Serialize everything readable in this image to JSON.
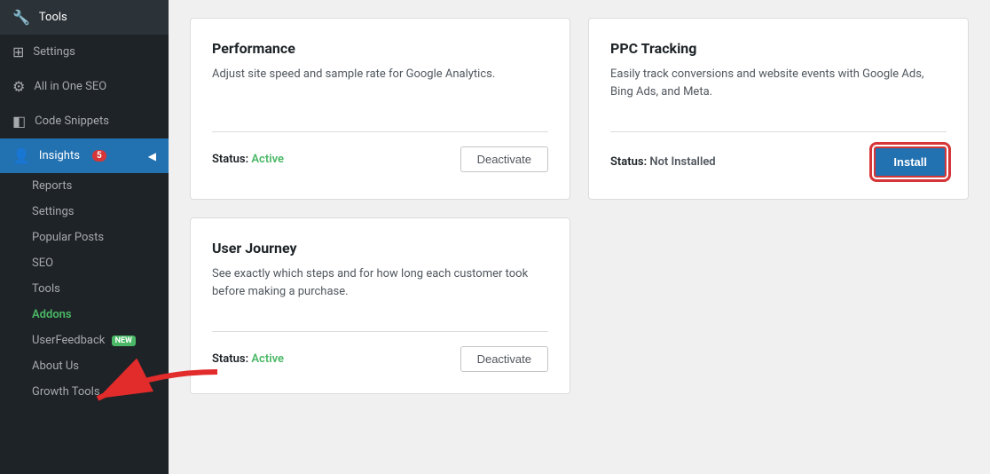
{
  "sidebar": {
    "items": [
      {
        "label": "Tools",
        "icon": "🔧",
        "id": "tools"
      },
      {
        "label": "Settings",
        "icon": "⊞",
        "id": "settings"
      },
      {
        "label": "All in One SEO",
        "icon": "⚙",
        "id": "aio-seo"
      },
      {
        "label": "Code Snippets",
        "icon": "◧",
        "id": "code-snippets"
      },
      {
        "label": "Insights",
        "icon": "👤",
        "id": "insights",
        "badge": "5"
      }
    ],
    "sub_items": [
      {
        "label": "Reports",
        "id": "reports"
      },
      {
        "label": "Settings",
        "id": "settings-sub"
      },
      {
        "label": "Popular Posts",
        "id": "popular-posts"
      },
      {
        "label": "SEO",
        "id": "seo"
      },
      {
        "label": "Tools",
        "id": "tools-sub"
      },
      {
        "label": "Addons",
        "id": "addons",
        "active": true
      },
      {
        "label": "UserFeedback",
        "id": "userfeedback",
        "new_badge": true
      },
      {
        "label": "About Us",
        "id": "about-us"
      },
      {
        "label": "Growth Tools",
        "id": "growth-tools"
      }
    ]
  },
  "cards": [
    {
      "id": "performance",
      "title": "Performance",
      "description": "Adjust site speed and sample rate for Google Analytics.",
      "status_label": "Status:",
      "status_value": "Active",
      "status_class": "active",
      "button_label": "Deactivate",
      "button_type": "deactivate"
    },
    {
      "id": "ppc-tracking",
      "title": "PPC Tracking",
      "description": "Easily track conversions and website events with Google Ads, Bing Ads, and Meta.",
      "status_label": "Status:",
      "status_value": "Not Installed",
      "status_class": "not-installed",
      "button_label": "Install",
      "button_type": "install"
    },
    {
      "id": "user-journey",
      "title": "User Journey",
      "description": "See exactly which steps and for how long each customer took before making a purchase.",
      "status_label": "Status:",
      "status_value": "Active",
      "status_class": "active",
      "button_label": "Deactivate",
      "button_type": "deactivate"
    }
  ],
  "colors": {
    "active": "#4ab866",
    "install_bg": "#2271b1",
    "highlight_border": "#d63638"
  }
}
